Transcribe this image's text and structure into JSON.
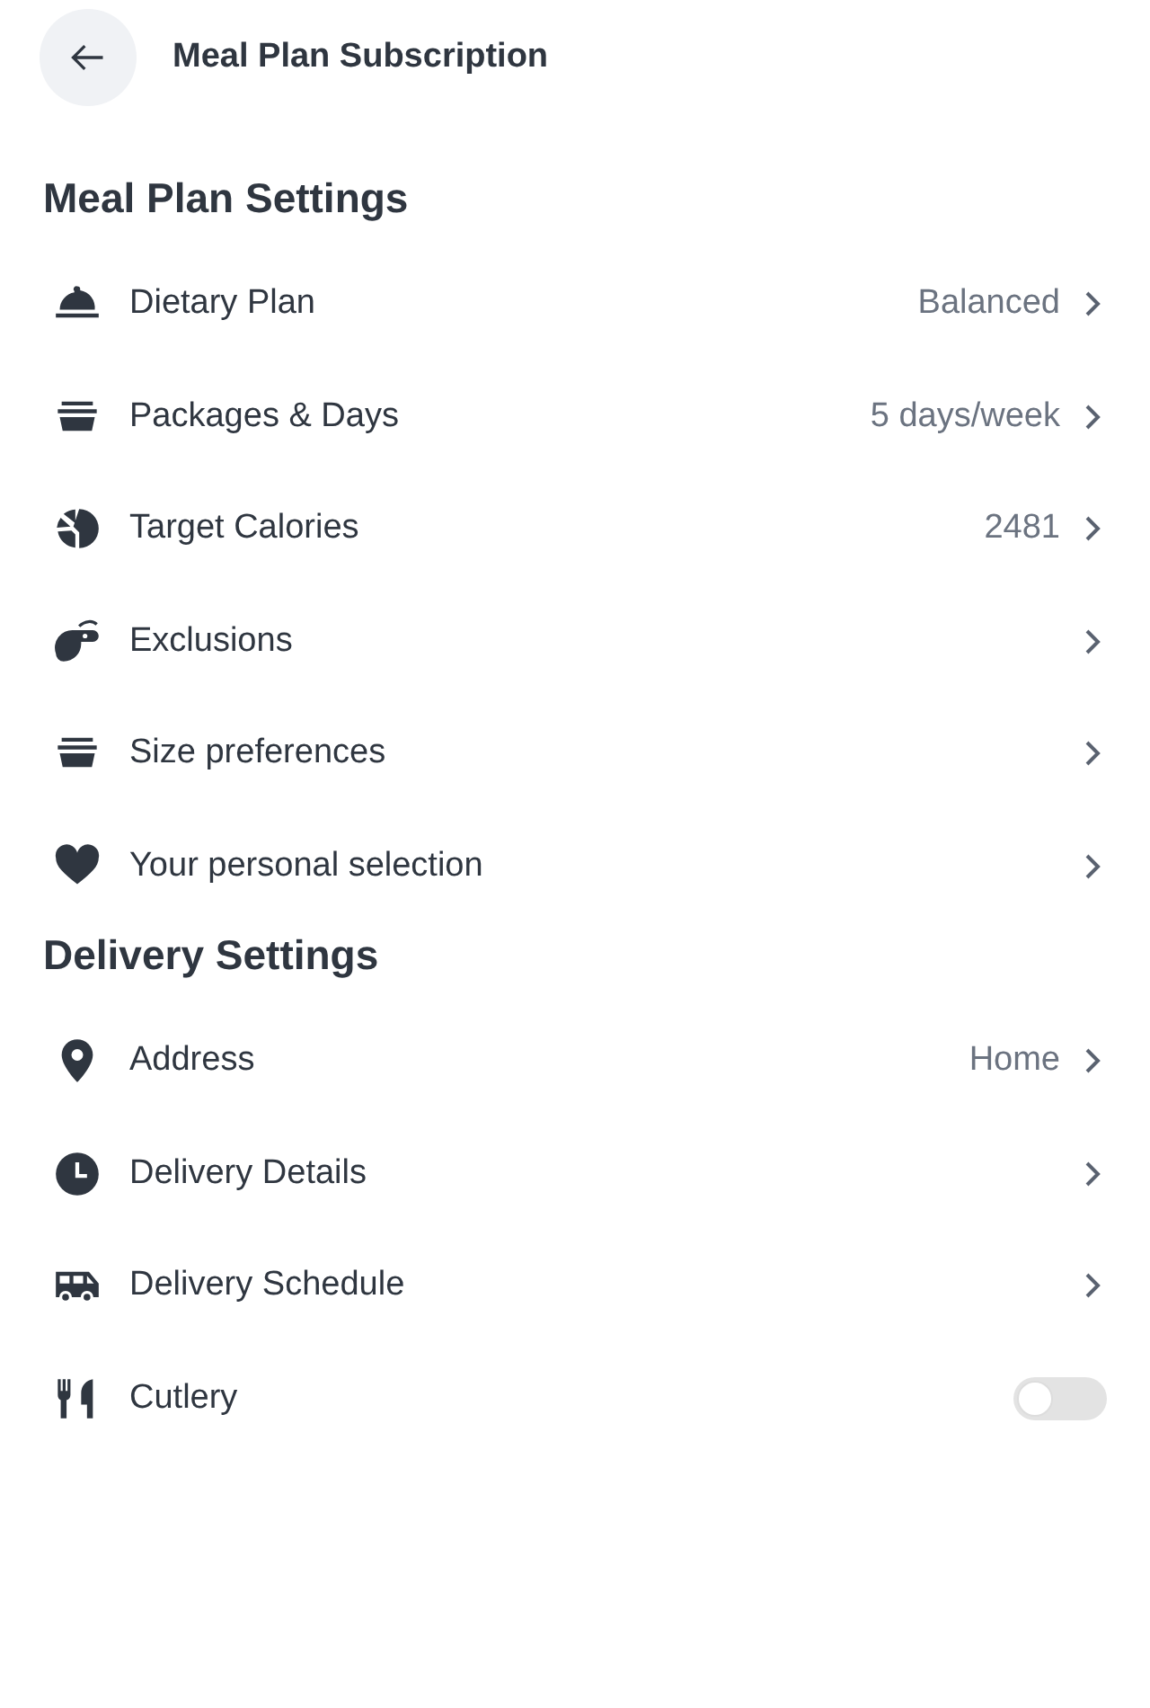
{
  "header": {
    "title": "Meal Plan Subscription"
  },
  "sections": [
    {
      "title": "Meal Plan Settings",
      "items": [
        {
          "kind": "link",
          "label": "Dietary Plan",
          "value": "Balanced"
        },
        {
          "kind": "link",
          "label": "Packages & Days",
          "value": "5 days/week"
        },
        {
          "kind": "link",
          "label": "Target Calories",
          "value": "2481"
        },
        {
          "kind": "link",
          "label": "Exclusions"
        },
        {
          "kind": "link",
          "label": "Size preferences"
        },
        {
          "kind": "link",
          "label": "Your personal selection"
        }
      ]
    },
    {
      "title": "Delivery Settings",
      "items": [
        {
          "kind": "link",
          "label": "Address",
          "value": "Home"
        },
        {
          "kind": "link",
          "label": "Delivery Details"
        },
        {
          "kind": "link",
          "label": "Delivery Schedule"
        },
        {
          "kind": "toggle",
          "label": "Cutlery",
          "on": false
        }
      ]
    }
  ]
}
